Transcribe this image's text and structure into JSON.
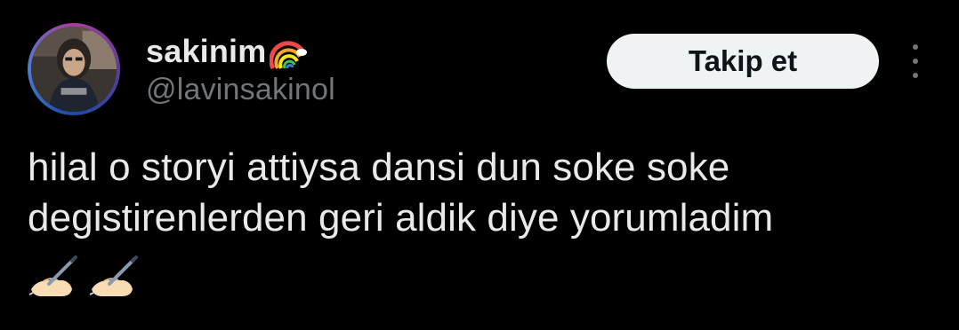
{
  "user": {
    "display_name": "sakinim",
    "name_emoji": "rainbow-icon",
    "handle": "@lavinsakinol",
    "avatar": "avatar-photo"
  },
  "actions": {
    "follow_label": "Takip et",
    "more_icon": "more-vertical-icon"
  },
  "tweet": {
    "line1": "hilal o storyi attiysa dansi dun soke soke",
    "line2": "degistirenlerden geri aldik diye yorumladim",
    "emojis": [
      "writing-hand-icon",
      "writing-hand-icon"
    ]
  },
  "colors": {
    "background": "#000000",
    "text_primary": "#e7e9ea",
    "text_secondary": "#71767b",
    "button_bg": "#eff3f4",
    "button_text": "#0f1419"
  }
}
